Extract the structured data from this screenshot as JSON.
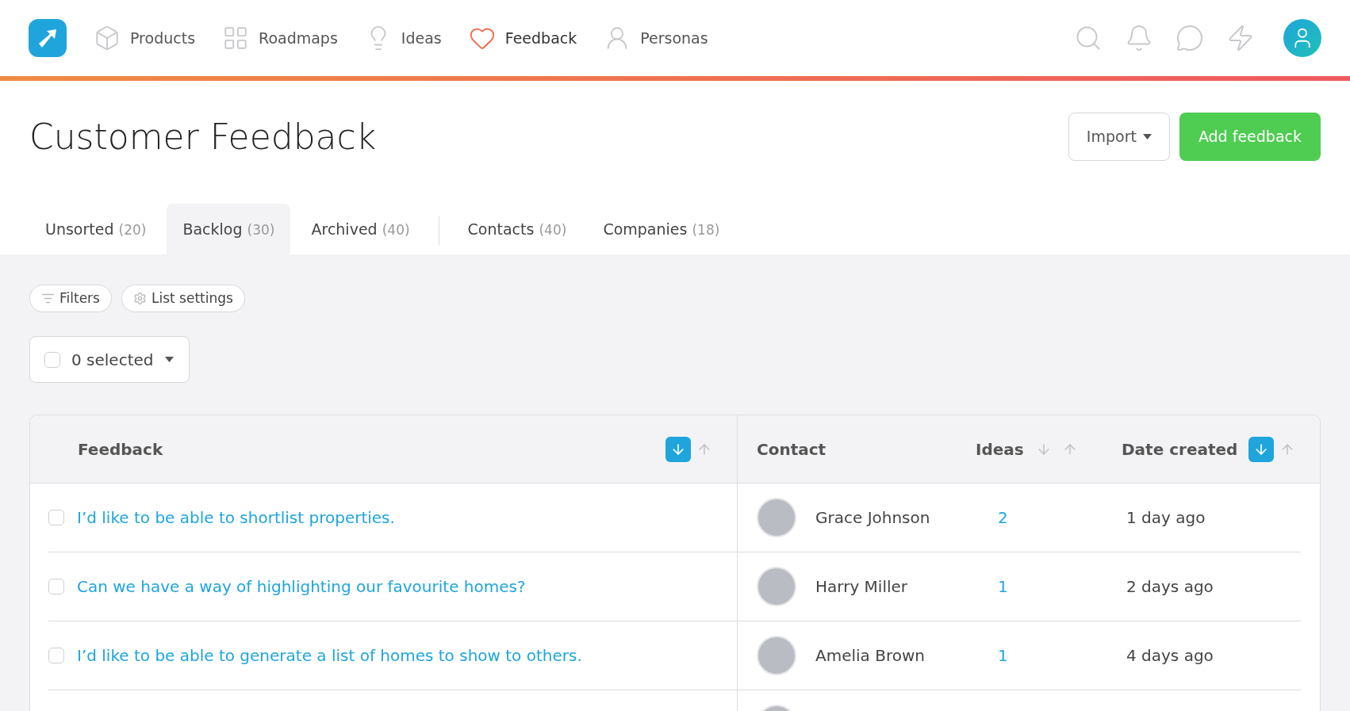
{
  "nav": {
    "items": [
      {
        "label": "Products",
        "selected": false
      },
      {
        "label": "Roadmaps",
        "selected": false
      },
      {
        "label": "Ideas",
        "selected": false
      },
      {
        "label": "Feedback",
        "selected": true
      },
      {
        "label": "Personas",
        "selected": false
      }
    ]
  },
  "page": {
    "title": "Customer Feedback",
    "import_button": "Import",
    "add_button": "Add feedback"
  },
  "tabs": [
    {
      "label": "Unsorted",
      "count": "(20)",
      "selected": false
    },
    {
      "label": "Backlog",
      "count": "(30)",
      "selected": true
    },
    {
      "label": "Archived",
      "count": "(40)",
      "selected": false
    },
    {
      "label": "Contacts",
      "count": "(40)",
      "selected": false
    },
    {
      "label": "Companies",
      "count": "(18)",
      "selected": false
    }
  ],
  "toolbar": {
    "filters": "Filters",
    "list_settings": "List settings",
    "selection": "0 selected",
    "select_all_checked": false
  },
  "table": {
    "columns": [
      {
        "label": "Feedback",
        "sort": {
          "down_selected": true
        }
      },
      {
        "label": "Contact"
      },
      {
        "label": "Ideas",
        "sort": {
          "down_selected": false
        }
      },
      {
        "label": "Date created",
        "sort": {
          "down_selected": true
        }
      }
    ],
    "rows": [
      {
        "checked": false,
        "feedback": "I’d like to be able to shortlist properties.",
        "contact": "Grace Johnson",
        "ideas": "2",
        "date": "1 day ago"
      },
      {
        "checked": false,
        "feedback": "Can we have a way of highlighting our favourite homes?",
        "contact": "Harry Miller",
        "ideas": "1",
        "date": "2 days ago"
      },
      {
        "checked": false,
        "feedback": "I’d like to be able to generate a list of homes to show to others.",
        "contact": "Amelia Brown",
        "ideas": "1",
        "date": "4 days ago"
      },
      {}
    ]
  }
}
